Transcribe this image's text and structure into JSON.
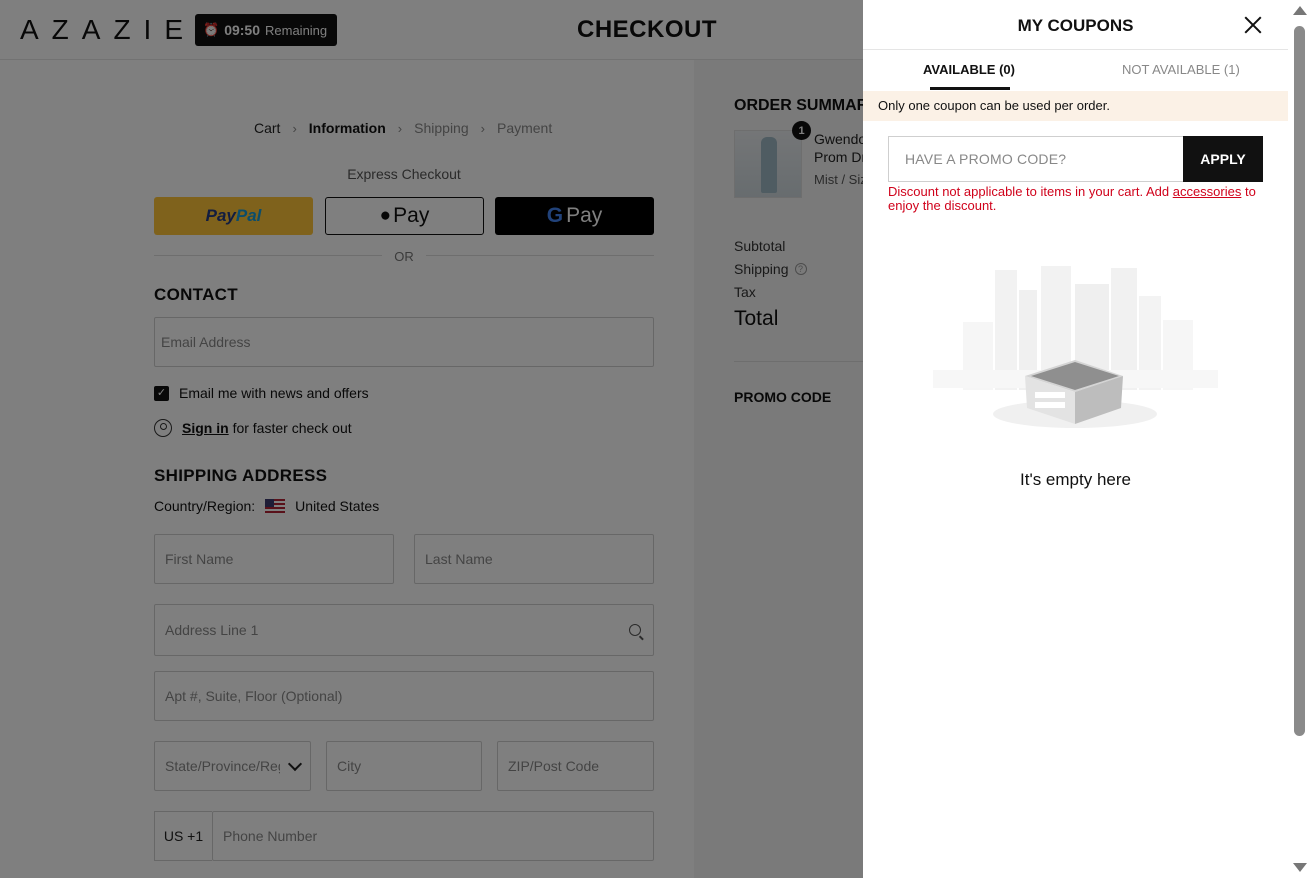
{
  "header": {
    "logo": "AZAZIE",
    "timer_time": "09:50",
    "timer_label": "Remaining",
    "title": "CHECKOUT"
  },
  "breadcrumb": [
    "Cart",
    "Information",
    "Shipping",
    "Payment"
  ],
  "express": {
    "label": "Express Checkout",
    "paypal_a": "Pay",
    "paypal_b": "Pal",
    "apple": "Pay",
    "google": "Pay",
    "or": "OR"
  },
  "contact": {
    "heading": "CONTACT",
    "email_placeholder": "Email Address",
    "newsletter": "Email me with news and offers",
    "sign_in": "Sign in",
    "sign_in_suffix": "for faster check out"
  },
  "shipping": {
    "heading": "SHIPPING ADDRESS",
    "country_label": "Country/Region:",
    "country": "United States",
    "first_name": "First Name",
    "last_name": "Last Name",
    "address1": "Address Line 1",
    "address2": "Apt #, Suite, Floor (Optional)",
    "state": "State/Province/Region",
    "city": "City",
    "zip": "ZIP/Post Code",
    "phone_prefix": "US +1",
    "phone": "Phone Number"
  },
  "order": {
    "heading": "ORDER SUMMARY",
    "qty": "1",
    "item_line1": "Gwendolyn",
    "item_line2": "Prom Dress",
    "item_line3": "Mist / Size",
    "subtotal": "Subtotal",
    "shipping": "Shipping",
    "tax": "Tax",
    "total": "Total",
    "promo": "PROMO CODE"
  },
  "coupons": {
    "title": "MY COUPONS",
    "tab_available": "AVAILABLE (0)",
    "tab_not_available": "NOT AVAILABLE (1)",
    "notice": "Only one coupon can be used per order.",
    "promo_placeholder": "HAVE A PROMO CODE?",
    "apply": "APPLY",
    "error_pre": "Discount not applicable to items in your cart. Add ",
    "error_link": "accessories",
    "error_post": " to enjoy the discount.",
    "empty": "It's empty here"
  },
  "colors": {
    "accent": "#111111",
    "error": "#d0021b",
    "notice_bg": "#fbf1e6",
    "paypal": "#ffc439"
  }
}
